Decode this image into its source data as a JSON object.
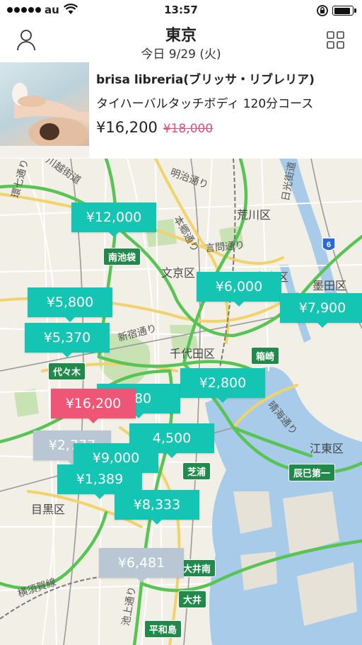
{
  "status_bar": {
    "carrier": "au",
    "time": "13:57",
    "battery_level": 0.9
  },
  "header": {
    "title": "東京",
    "date": "今日 9/29 (火)",
    "left_icon": "user-icon",
    "right_icon": "grid-icon"
  },
  "featured": {
    "shop_name": "brisa libreria(ブリッサ・リブレリア)",
    "course": "タイハーバルタッチボディ 120分コース",
    "price": "¥16,200",
    "original_price": "¥18,000"
  },
  "map": {
    "area_labels": [
      "荒川区",
      "文京区",
      "墨田区",
      "千代田区",
      "江東区",
      "目黒区",
      "台東区"
    ],
    "road_labels": [
      "川越街道",
      "明治通り",
      "日光街道",
      "本郷通り",
      "言問通り",
      "新宿通り",
      "晴海通り",
      "横須賀線",
      "池上通り",
      "環七通り"
    ],
    "stations": [
      "南池袋",
      "代々木",
      "箱崎",
      "芝浦",
      "辰巳第一",
      "大井南",
      "大井",
      "平和島"
    ],
    "expressway_number": "6",
    "pins": [
      {
        "label": "¥12,000",
        "style": "teal"
      },
      {
        "label": "¥6,000",
        "style": "teal"
      },
      {
        "label": "¥7,900",
        "style": "teal"
      },
      {
        "label": "¥5,800",
        "style": "teal"
      },
      {
        "label": "¥5,370",
        "style": "teal"
      },
      {
        "label": "¥2,800",
        "style": "teal"
      },
      {
        "label": "880",
        "style": "teal"
      },
      {
        "label": "4,500",
        "style": "teal"
      },
      {
        "label": "¥16,200",
        "style": "selected"
      },
      {
        "label": "¥2,777",
        "style": "gray"
      },
      {
        "label": "¥9,000",
        "style": "teal"
      },
      {
        "label": "¥1,389",
        "style": "teal"
      },
      {
        "label": "¥8,333",
        "style": "teal"
      },
      {
        "label": "¥6,481",
        "style": "gray"
      }
    ]
  },
  "colors": {
    "pin_teal": "#15c5b4",
    "pin_selected": "#ef5576",
    "pin_gray": "#b9c6d3",
    "old_price": "#e05079",
    "station": "#1f8a4a",
    "water": "#a7cbe8",
    "park": "#c8e2b4"
  }
}
